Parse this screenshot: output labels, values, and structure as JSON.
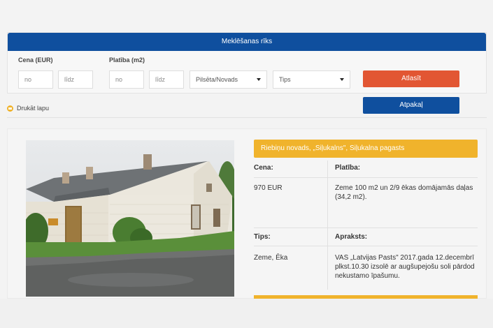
{
  "search": {
    "title": "Meklēšanas rīks",
    "price_label": "Cena (EUR)",
    "area_label": "Platība (m2)",
    "price_from_placeholder": "no",
    "price_to_placeholder": "līdz",
    "area_from_placeholder": "no",
    "area_to_placeholder": "līdz",
    "city_select": "Pilsēta/Novads",
    "type_select": "Tips",
    "filter_button": "Atlasīt",
    "back_button": "Atpakaļ"
  },
  "print": {
    "label": "Drukāt lapu"
  },
  "listing": {
    "location": "Riebiņu novads, „Siļukalns\", Siļukalna pagasts",
    "price_header": "Cena:",
    "area_header": "Platība:",
    "price_value": "970 EUR",
    "area_value": "Zeme 100 m2 un 2/9 ēkas domājamās daļas (34,2 m2).",
    "type_header": "Tips:",
    "desc_header": "Apraksts:",
    "type_value": "Zeme, Ēka",
    "desc_value": "VAS „Latvijas Pasts\" 2017.gada 12.decembrī plkst.10.30 izsolē ar augšupejošu soli pārdod nekustamo īpašumu."
  },
  "colors": {
    "primary_blue": "#0f4f9e",
    "accent_orange": "#f0b32c",
    "button_red": "#e25633"
  }
}
